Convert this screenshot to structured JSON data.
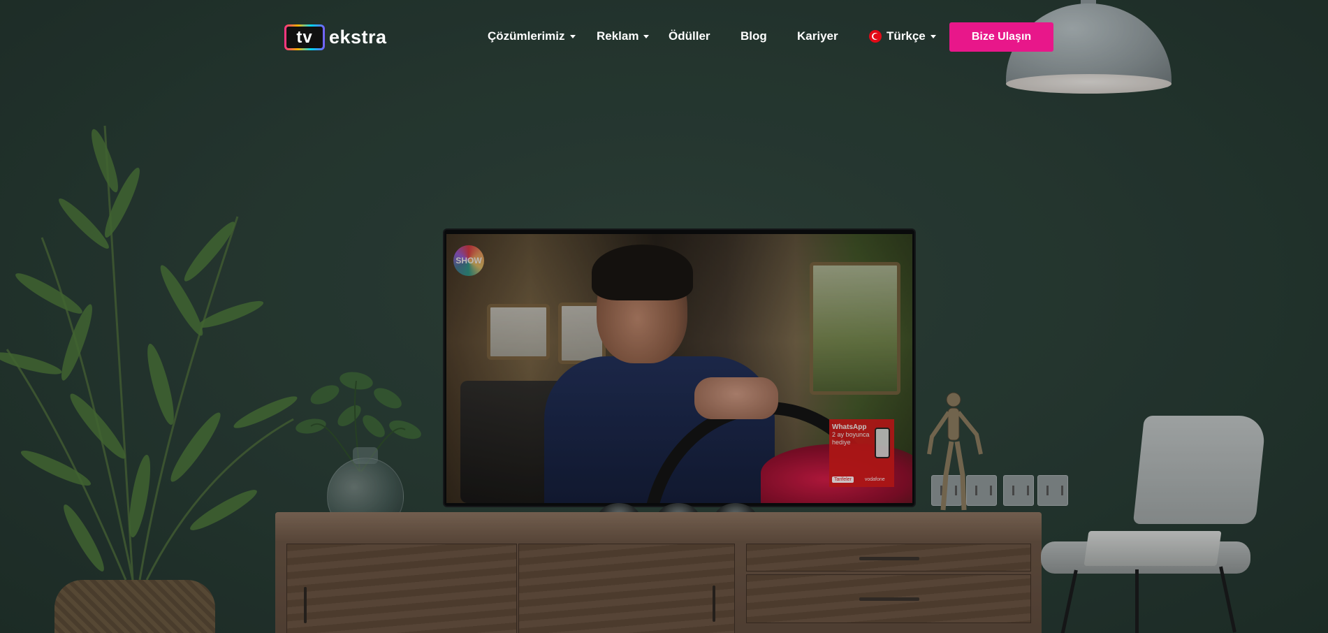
{
  "brand": {
    "logo_tv": "tv",
    "logo_text": "ekstra"
  },
  "nav": {
    "items": [
      {
        "label": "Çözümlerimiz",
        "has_dropdown": true
      },
      {
        "label": "Reklam",
        "has_dropdown": true
      },
      {
        "label": "Ödüller",
        "has_dropdown": false
      },
      {
        "label": "Blog",
        "has_dropdown": false
      },
      {
        "label": "Kariyer",
        "has_dropdown": false
      }
    ],
    "language": {
      "label": "Türkçe",
      "icon": "turkey-flag-icon",
      "has_dropdown": true
    },
    "cta_label": "Bize Ulaşın"
  },
  "tv_screen": {
    "channel_logo": "SHOW",
    "ad": {
      "title": "WhatsApp",
      "line1": "2 ay boyunca",
      "line2": "hediye",
      "badge": "Tarifeler",
      "brand": "vodafone"
    }
  },
  "colors": {
    "accent": "#e8178a",
    "wall": "#2c4139",
    "nav_text": "#ffffff"
  }
}
